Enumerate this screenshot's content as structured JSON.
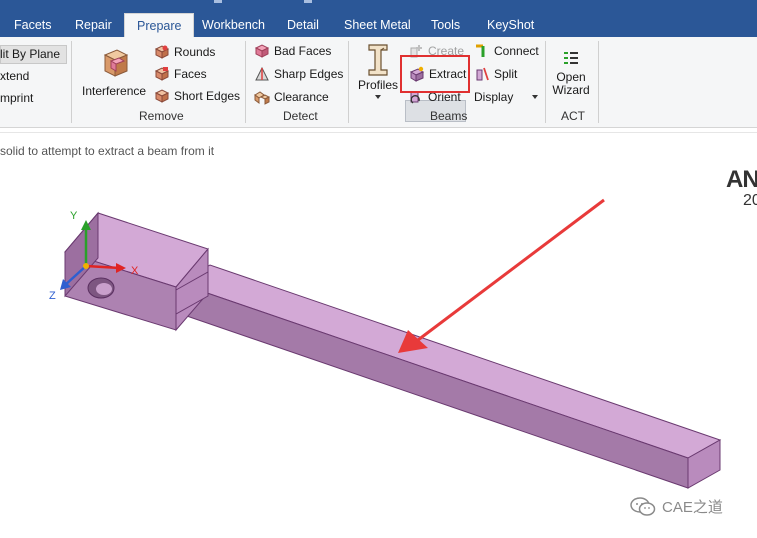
{
  "tabs": [
    {
      "label": "Facets"
    },
    {
      "label": "Repair"
    },
    {
      "label": "Prepare",
      "active": true
    },
    {
      "label": "Workbench"
    },
    {
      "label": "Detail"
    },
    {
      "label": "Sheet Metal"
    },
    {
      "label": "Tools"
    },
    {
      "label": "KeyShot"
    }
  ],
  "ribbon": {
    "partial_group": {
      "split_by_plane": "lit By Plane",
      "extend": "xtend",
      "imprint": "mprint"
    },
    "remove": {
      "label": "Remove",
      "interference": "Interference",
      "rounds": "Rounds",
      "faces": "Faces",
      "short_edges": "Short Edges"
    },
    "detect": {
      "label": "Detect",
      "bad_faces": "Bad Faces",
      "sharp_edges": "Sharp Edges",
      "clearance": "Clearance"
    },
    "beams": {
      "label": "Beams",
      "profiles": "Profiles",
      "create": "Create",
      "extract": "Extract",
      "orient": "Orient",
      "connect": "Connect",
      "split": "Split",
      "display": "Display"
    },
    "act": {
      "label": "ACT",
      "open_wizard_line1": "Open",
      "open_wizard_line2": "Wizard"
    }
  },
  "hint_text": "solid to attempt to extract a beam from it",
  "brand": {
    "name": "AN",
    "year": "20"
  },
  "triad": {
    "x": "X",
    "y": "Y",
    "z": "Z"
  },
  "watermark": "CAE之道",
  "colors": {
    "tab_bar": "#2b5797",
    "ribbon_bg": "#f5f6f7",
    "highlight": "#e03030",
    "arrow": "#e83a3a",
    "part_top": "#d3a9d6",
    "part_front": "#b98bbd",
    "part_side": "#9c6fa0",
    "axis_x": "#e02424",
    "axis_y": "#2aa02a",
    "axis_z": "#2f5fd0"
  }
}
